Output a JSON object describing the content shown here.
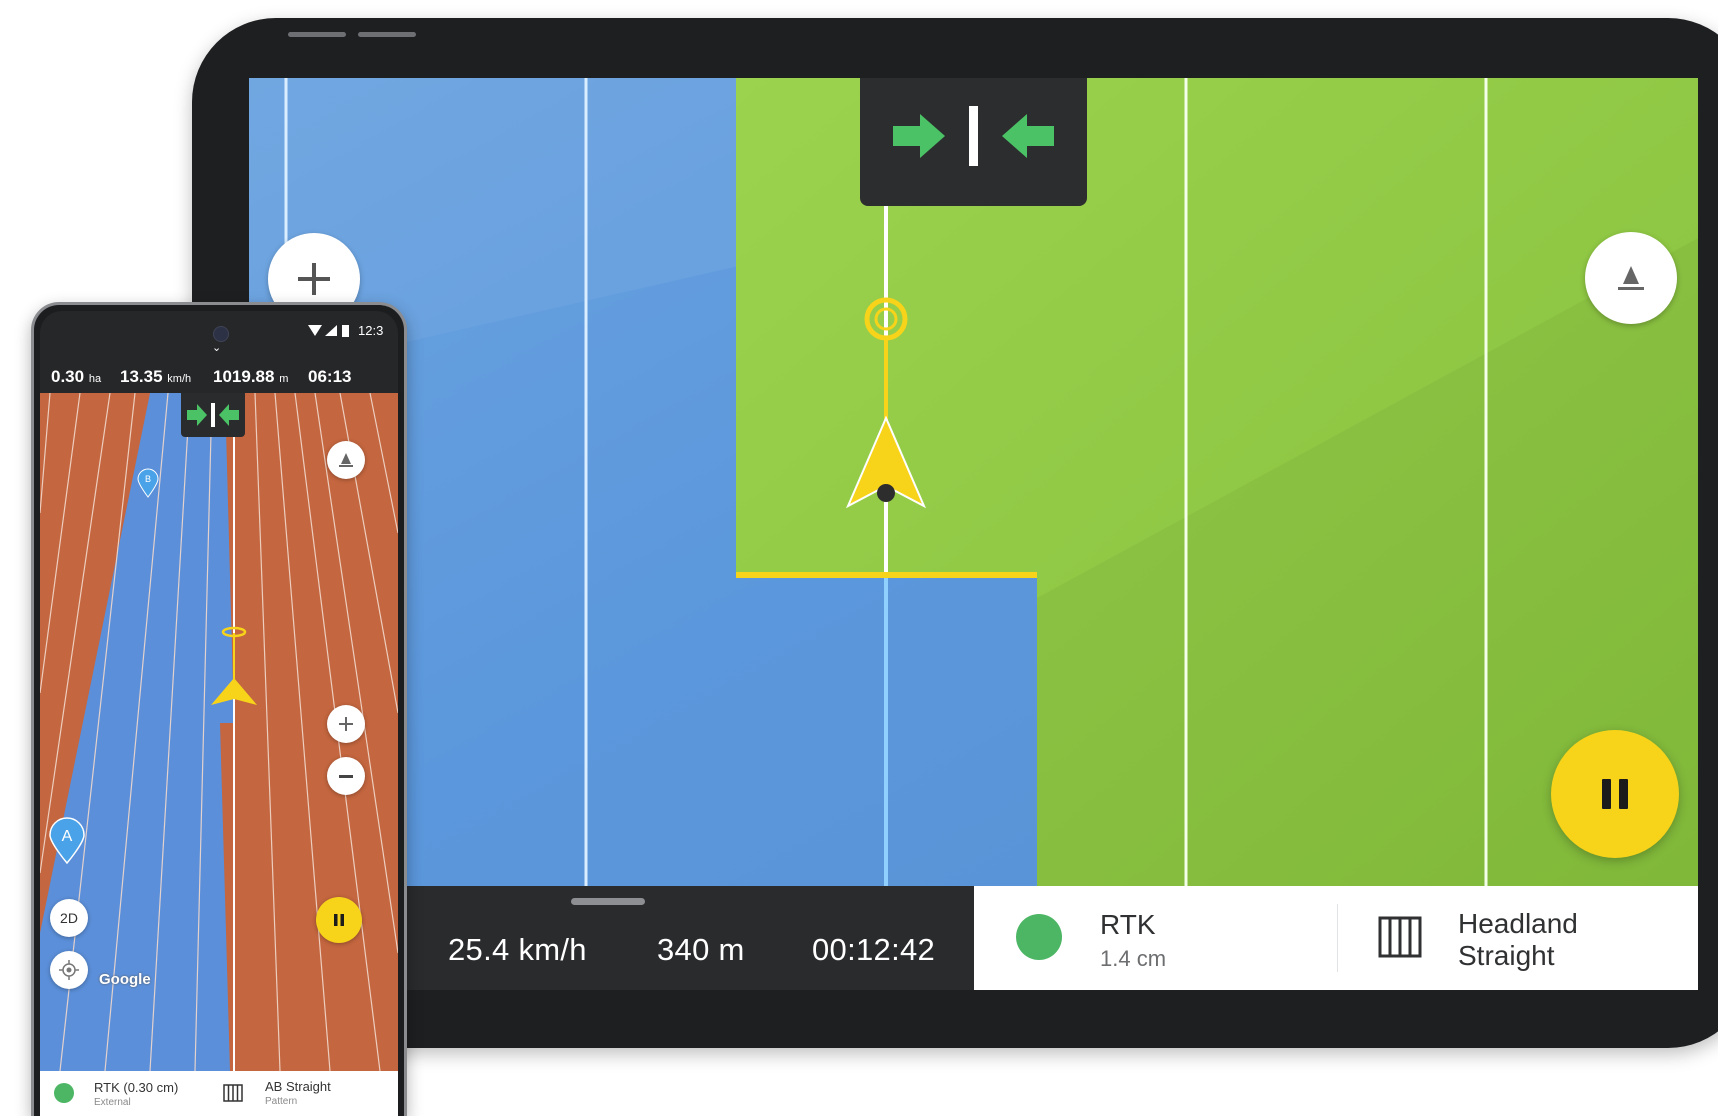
{
  "tablet": {
    "colors": {
      "worked_area": "#5b97dc",
      "unworked_area": "#8cc63f",
      "guide_line": "#f7d31a",
      "pause_button": "#f7d31a",
      "rtk_status": "#4cb665"
    },
    "icons": {
      "zoom": "plus-icon",
      "compass": "compass-north-icon",
      "pause": "pause-icon",
      "guidance": "arrows-centered-icon",
      "vehicle": "vehicle-arrow-icon",
      "pattern": "pattern-columns-icon"
    },
    "stats": {
      "speed": "25.4 km/h",
      "distance": "340 m",
      "time": "00:12:42"
    },
    "rtk": {
      "title": "RTK",
      "accuracy": "1.4 cm"
    },
    "pattern": {
      "line1": "Headland",
      "line2": "Straight"
    }
  },
  "phone": {
    "colors": {
      "unworked_area": "#c4663f",
      "worked_area": "#5b8fd9",
      "pause_button": "#f7d31a",
      "rtk_status": "#4cb665"
    },
    "icons": {
      "compass": "compass-north-icon",
      "zoom_in": "plus-icon",
      "zoom_out": "minus-icon",
      "pause": "pause-icon",
      "locate": "locate-icon",
      "point_a": "map-pin-a-icon",
      "point_b": "map-pin-b-icon"
    },
    "status_time": "12:3",
    "stats": {
      "area": "0.30",
      "area_unit": "ha",
      "speed": "13.35",
      "speed_unit": "km/h",
      "distance": "1019.88",
      "distance_unit": "m",
      "time": "06:13"
    },
    "view_mode": "2D",
    "pin_a": "A",
    "pin_b": "B",
    "map_attribution": "Google",
    "rtk": {
      "title": "RTK (0.30 cm)",
      "source": "External"
    },
    "pattern": {
      "title": "AB Straight",
      "label": "Pattern"
    }
  }
}
